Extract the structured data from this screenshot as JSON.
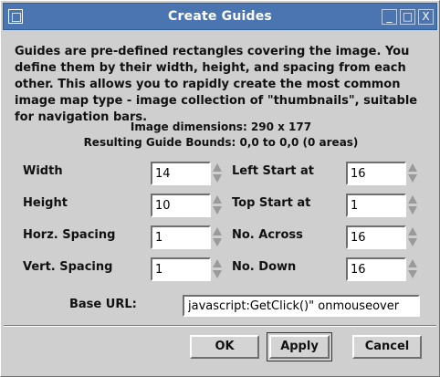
{
  "window": {
    "title": "Create Guides",
    "controls": {
      "minimize": "_",
      "maximize": "□",
      "close": "X"
    }
  },
  "description": "Guides are pre-defined rectangles covering the image. You define them by their width, height, and spacing from each other. This allows you to rapidly create the most common image map type - image collection of \"thumbnails\", suitable for navigation bars.",
  "info": {
    "image_dimensions": "Image dimensions: 290 x 177",
    "resulting_bounds": "Resulting Guide Bounds: 0,0 to 0,0 (0 areas)"
  },
  "fields": {
    "width": {
      "label": "Width",
      "value": "14"
    },
    "height": {
      "label": "Height",
      "value": "10"
    },
    "horz_spacing": {
      "label": "Horz. Spacing",
      "value": "1"
    },
    "vert_spacing": {
      "label": "Vert. Spacing",
      "value": "1"
    },
    "left_start": {
      "label": "Left Start at",
      "value": "16"
    },
    "top_start": {
      "label": "Top Start at",
      "value": "1"
    },
    "no_across": {
      "label": "No. Across",
      "value": "16"
    },
    "no_down": {
      "label": "No. Down",
      "value": "16"
    }
  },
  "base_url": {
    "label": "Base URL:",
    "value": "javascript:GetClick()\" onmouseover"
  },
  "buttons": {
    "ok": "OK",
    "apply": "Apply",
    "cancel": "Cancel"
  }
}
